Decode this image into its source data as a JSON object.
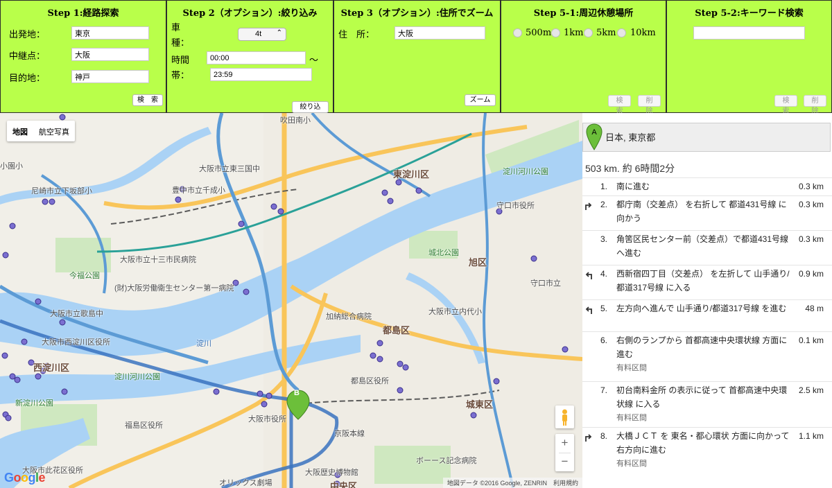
{
  "step1": {
    "title": "Step 1:経路探索",
    "origin_label": "出発地：",
    "origin_value": "東京",
    "waypoint_label": "中継点：",
    "waypoint_value": "大阪",
    "destination_label": "目的地：",
    "destination_value": "神戸",
    "search_button": "検　索"
  },
  "step2": {
    "title": "Step 2（オプション）:絞り込み",
    "vehicle_label_1": "車",
    "vehicle_label_2": "種：",
    "vehicle_value": "4t",
    "time_label_1": "時間",
    "time_label_2": "帯：",
    "time_from": "00:00",
    "tilde": "〜",
    "time_to": "23:59",
    "filter_button": "絞り込む"
  },
  "step3": {
    "title": "Step 3（オプション）:住所でズーム",
    "address_label": "住　所：",
    "address_value": "大阪",
    "zoom_button": "ズーム"
  },
  "step51": {
    "title": "Step 5-1:周辺休憩場所",
    "options": [
      "500m",
      "1km",
      "5km",
      "10km"
    ],
    "search_button": "検索",
    "delete_button": "削除"
  },
  "step52": {
    "title": "Step 5-2:キーワード検索",
    "keyword_value": "",
    "search_button": "検索",
    "delete_button": "削除"
  },
  "map": {
    "type_map": "地図",
    "type_satellite": "航空写真",
    "zoom_in": "+",
    "zoom_out": "−",
    "logo": "Google",
    "attribution": "地図データ ©2016 Google, ZENRIN　利用規約",
    "marker_b": "B",
    "labels": {
      "l1": "吹田南小",
      "l2": "大阪市立東三国中",
      "l3": "豊中市立千成小",
      "l4": "尼崎市立下坂部小",
      "l5": "東淀川区",
      "l6": "淀川河川公園",
      "l7": "守口市役所",
      "l8": "城北公園",
      "l9": "旭区",
      "l10": "大阪市立十三市民病院",
      "l11": "(財)大阪労働衛生センター第一病院",
      "l12": "今福公園",
      "l13": "大阪市立歌島中",
      "l14": "大阪市立内代小",
      "l15": "加納総合病院",
      "l16": "都島区",
      "l17": "大阪市西淀川区役所",
      "l18": "西淀川区",
      "l19": "淀川河川公園",
      "l20": "都島区役所",
      "l21": "新淀川公園",
      "l22": "福島区役所",
      "l23": "大阪市役所",
      "l24": "城東区",
      "l25": "京阪本線",
      "l26": "大阪市此花区役所",
      "l27": "大阪歴史博物館",
      "l28": "ボーース記念病院",
      "l29": "中央区",
      "l30": "オリックス劇場",
      "l31": "守口市立",
      "l32": "小園小",
      "l33": "淀川"
    }
  },
  "directions": {
    "start_address": "日本, 東京都",
    "marker_a": "A",
    "summary": "503 km. 約 6時間2分",
    "steps": [
      {
        "num": "1.",
        "text": "南に進む",
        "dist": "0.3 km",
        "note": ""
      },
      {
        "num": "2.",
        "text": "都庁南（交差点） を右折して 都道431号線 に向かう",
        "dist": "0.3 km",
        "note": ""
      },
      {
        "num": "3.",
        "text": "角筈区民センター前（交差点）で都道431号線へ進む",
        "dist": "0.3 km",
        "note": ""
      },
      {
        "num": "4.",
        "text": "西新宿四丁目（交差点） を左折して 山手通り/都道317号線 に入る",
        "dist": "0.9 km",
        "note": ""
      },
      {
        "num": "5.",
        "text": "左方向へ進んで 山手通り/都道317号線 を進む",
        "dist": "48 m",
        "note": ""
      },
      {
        "num": "6.",
        "text": "右側のランプから 首都高速中央環状線 方面に進む",
        "dist": "0.1 km",
        "note": "有料区間"
      },
      {
        "num": "7.",
        "text": "初台南料金所 の表示に従って 首都高速中央環状線 に入る",
        "dist": "2.5 km",
        "note": "有料区間"
      },
      {
        "num": "8.",
        "text": "大橋ＪＣＴ を 東名・都心環状 方面に向かって右方向に進む",
        "dist": "1.1 km",
        "note": "有料区間"
      }
    ]
  }
}
